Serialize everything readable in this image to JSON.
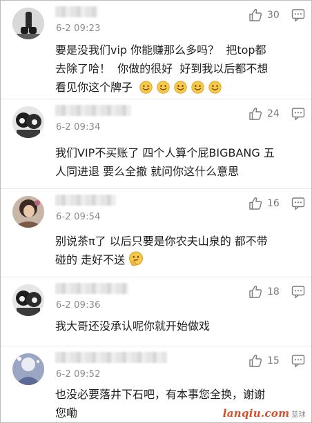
{
  "comments": [
    {
      "time": "6-2 09:23",
      "likes": "30",
      "text_line1": "要是没我们vip 你能赚那么多吗？  把top都",
      "text_line2": "去除了哈！  你做的很好  好到我以后都不想",
      "text_line3": "看见你这个牌子",
      "emoji_count": 5
    },
    {
      "time": "6-2 09:34",
      "likes": "24",
      "text_line1": "我们VIP不买账了 四个人算个屁BIGBANG 五",
      "text_line2": "人同进退 要么全撤 就问你这什么意思"
    },
    {
      "time": "6-2 09:54",
      "likes": "16",
      "text_line1": "别说茶π了 以后只要是你农夫山泉的 都不带",
      "text_line2": "碰的 走好不送"
    },
    {
      "time": "6-2 09:36",
      "likes": "18",
      "text_line1": "我大哥还没承认呢你就开始做戏"
    },
    {
      "time": "6-2 09:52",
      "likes": "15",
      "text_line1": "也没必要落井下石吧，有本事您全换，谢谢",
      "text_line2": "您嘞"
    }
  ],
  "watermark": {
    "brand": "lanqiu.com",
    "sub": "蓝球"
  },
  "colors": {
    "text": "#1e1e1e",
    "meta": "#8a8a8a",
    "divider": "#e8e8e8",
    "watermark": "#d24f2b"
  },
  "icons": [
    "thumbs-up-icon",
    "reply-icon",
    "smile-emoji-icon",
    "thinking-emoji-icon"
  ]
}
